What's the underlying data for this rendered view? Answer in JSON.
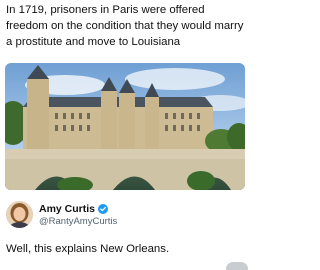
{
  "post": {
    "caption": "In 1719, prisoners in Paris were offered freedom on the condition that they would marry a prostitute and move to Louisiana",
    "image": {
      "icon": "photo-conciergerie"
    }
  },
  "quote": {
    "author_name": "Amy Curtis",
    "author_handle": "@RantyAmyCurtis",
    "verified_icon": "verified-badge-icon",
    "verified_color": "#1d9bf0",
    "text": "Well, this explains New Orleans."
  }
}
